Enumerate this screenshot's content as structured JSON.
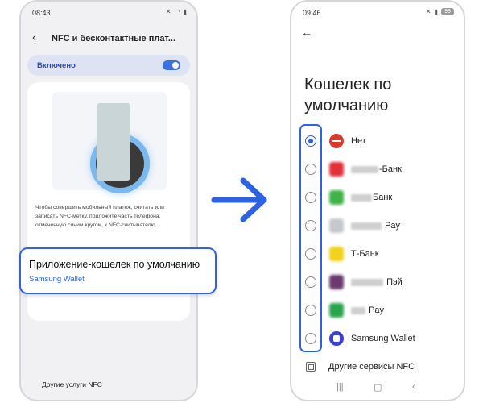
{
  "left_phone": {
    "status_time": "08:43",
    "header_title": "NFC и бесконтактные плат...",
    "toggle_label": "Включено",
    "description": "Чтобы совершить мобильный платеж, считать или записать NFC-метку, приложите часть телефона, отмеченную синим кругом, к NFC-считывателю.",
    "callout_title": "Приложение-кошелек по умолчанию",
    "callout_value": "Samsung Wallet",
    "other_services": "Другие услуги NFC"
  },
  "right_phone": {
    "status_time": "09:46",
    "battery": "99",
    "title": "Кошелек по умолчанию",
    "options": [
      {
        "label": "Нет",
        "selected": true,
        "icon": "no-entry-icon",
        "color": "#d63b2f"
      },
      {
        "label": "-Банк",
        "selected": false,
        "icon": "bank-app-icon",
        "color": "#e0303a"
      },
      {
        "label": "Банк",
        "selected": false,
        "icon": "bank-app-icon",
        "color": "#3fb24a"
      },
      {
        "label": "Pay",
        "selected": false,
        "icon": "pay-app-icon",
        "color": "#9aa3a8"
      },
      {
        "label": "Т-Банк",
        "selected": false,
        "icon": "bank-app-icon",
        "color": "#f2d21b"
      },
      {
        "label": "Пэй",
        "selected": false,
        "icon": "pay-app-icon",
        "color": "#6a3a6e"
      },
      {
        "label": "Pay",
        "selected": false,
        "icon": "pay-app-icon",
        "color": "#2aa44f"
      },
      {
        "label": "Samsung Wallet",
        "selected": false,
        "icon": "samsung-wallet-icon",
        "color": "#3b3fd6"
      }
    ],
    "other_services": "Другие сервисы NFC"
  },
  "accent_color": "#2d63e2"
}
